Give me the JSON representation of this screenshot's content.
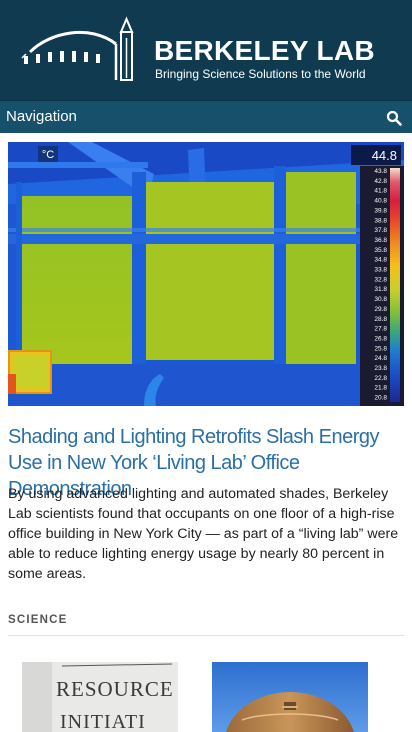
{
  "brand": {
    "title": "BERKELEY LAB",
    "tagline": "Bringing Science Solutions to the World"
  },
  "nav": {
    "label": "Navigation",
    "search_icon": "search-icon"
  },
  "hero": {
    "unit": "°C",
    "readout": "44.8",
    "scale": [
      "43.8",
      "42.8",
      "41.8",
      "40.8",
      "39.8",
      "38.8",
      "37.8",
      "36.8",
      "35.8",
      "34.8",
      "33.8",
      "32.8",
      "31.8",
      "30.8",
      "29.8",
      "28.8",
      "27.8",
      "26.8",
      "25.8",
      "24.8",
      "23.8",
      "22.8",
      "21.8",
      "20.8"
    ]
  },
  "article": {
    "headline": "Shading and Lighting Retrofits Slash Energy Use in New York ‘Living Lab’ Office Demonstration",
    "summary": "By using advanced lighting and automated shades, Berkeley Lab scientists found that occupants on one floor of a high-rise office building in New York City — as part of a “living lab” were able to reduce lighting energy usage by nearly 80 percent in some areas."
  },
  "section": {
    "label": "SCIENCE"
  },
  "thumb1": {
    "line1": "RESOURCE",
    "line2": "INITIATI"
  }
}
